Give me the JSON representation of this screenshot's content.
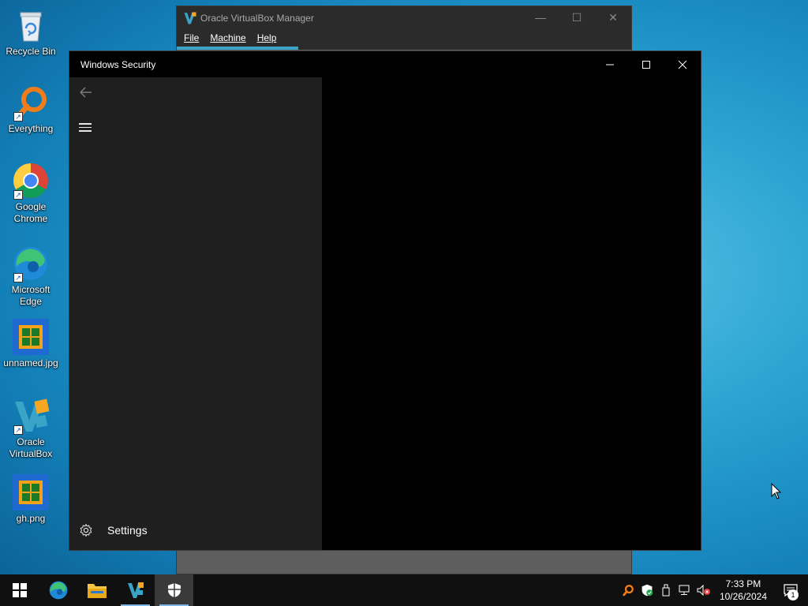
{
  "desktop": {
    "icons": [
      {
        "label": "Recycle Bin",
        "icon": "recycle-bin-icon"
      },
      {
        "label": "Everything",
        "icon": "everything-search-icon"
      },
      {
        "label": "Google Chrome",
        "icon": "chrome-icon"
      },
      {
        "label": "Microsoft Edge",
        "icon": "edge-icon"
      },
      {
        "label": "unnamed.jpg",
        "icon": "image-file-icon"
      },
      {
        "label": "Oracle VirtualBox",
        "icon": "virtualbox-icon"
      },
      {
        "label": "gh.png",
        "icon": "image-file-icon"
      }
    ]
  },
  "vbox": {
    "title": "Oracle VirtualBox Manager",
    "menu": [
      "File",
      "Machine",
      "Help"
    ],
    "controls": {
      "minimize": "—",
      "maximize": "☐",
      "close": "✕"
    }
  },
  "security": {
    "title": "Windows Security",
    "settings_label": "Settings"
  },
  "taskbar": {
    "pinned": [
      "start-button",
      "edge",
      "file-explorer",
      "virtualbox",
      "windows-security"
    ],
    "clock_time": "7:33 PM",
    "clock_date": "10/26/2024",
    "notification_count": "1"
  },
  "colors": {
    "accent": "#3aa3c8",
    "security_sidebar": "#1f1f1f",
    "taskbar": "#101010"
  }
}
